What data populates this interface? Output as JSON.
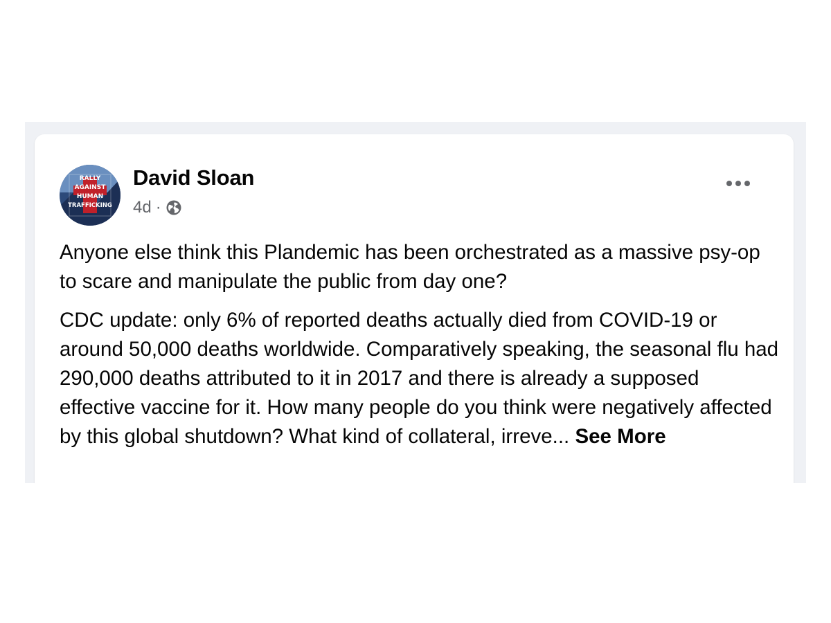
{
  "post": {
    "author": "David Sloan",
    "timestamp": "4d",
    "separator": "·",
    "privacy_icon": "globe-icon",
    "avatar_text": [
      "RALLY",
      "AGAINST",
      "HUMAN",
      "TRAFFICKING"
    ],
    "more_icon": "more-options-icon",
    "paragraph_1": "Anyone else think this Plandemic has been orchestrated as a massive psy-op to scare and manipulate the public from day one?",
    "paragraph_2": "CDC update: only 6% of reported deaths actually died from COVID-19 or around 50,000 deaths worldwide. Comparatively speaking, the seasonal flu had 290,000 deaths attributed to it in 2017 and there is already a supposed effective vaccine for it. How many people do you think were negatively affected by this global shutdown? What kind of collateral, irreve...",
    "see_more_label": "See More"
  },
  "colors": {
    "feed_background": "#eff1f5",
    "card_background": "#ffffff",
    "primary_text": "#050505",
    "secondary_text": "#65676b"
  }
}
